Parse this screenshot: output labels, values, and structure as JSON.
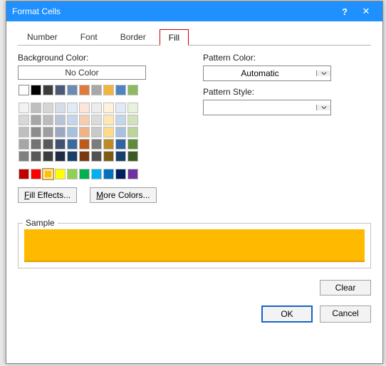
{
  "window": {
    "title": "Format Cells"
  },
  "tabs": {
    "items": [
      {
        "label": "Number"
      },
      {
        "label": "Font"
      },
      {
        "label": "Border"
      },
      {
        "label": "Fill"
      }
    ],
    "active_index": 3
  },
  "fill": {
    "background_color_label": "Background Color:",
    "no_color_label": "No Color",
    "fill_effects_label": "Fill Effects...",
    "more_colors_label": "More Colors...",
    "selected_index": 62,
    "colors": [
      "#ffffff",
      "#000000",
      "#3c3c3c",
      "#4a5a78",
      "#6b8bb3",
      "#e07a3c",
      "#a8a8a8",
      "#f2b63d",
      "#4f84c4",
      "#8fb95f",
      "#f2f2f2",
      "#bfbfbf",
      "#d6d6d6",
      "#d6dde8",
      "#e2ebf5",
      "#fbe6d9",
      "#ededed",
      "#fff3d9",
      "#e1eaf4",
      "#e8f1dc",
      "#d8d8d8",
      "#a6a6a6",
      "#bcbcbc",
      "#b9c4d6",
      "#c5d6ea",
      "#f6cdb1",
      "#dbdbdb",
      "#ffe8b3",
      "#c4d6ea",
      "#d2e2ba",
      "#bfbfbf",
      "#8c8c8c",
      "#9e9e9e",
      "#9aa9c2",
      "#a6c0de",
      "#f0b384",
      "#c9c9c9",
      "#ffdb87",
      "#a7c1de",
      "#bcd498",
      "#a6a6a6",
      "#737373",
      "#595959",
      "#425173",
      "#3b6aa0",
      "#c05a1a",
      "#7c7c7c",
      "#bd8b23",
      "#2e65a3",
      "#5f8c3a",
      "#808080",
      "#595959",
      "#3c3c3c",
      "#1e2b44",
      "#1b3e66",
      "#7a3910",
      "#525252",
      "#7d5b15",
      "#163f6b",
      "#3c5a23",
      "#c00000",
      "#ff0000",
      "#ffc000",
      "#ffff00",
      "#92d050",
      "#00b050",
      "#00b0f0",
      "#0070c0",
      "#002060",
      "#7030a0"
    ]
  },
  "pattern": {
    "color_label": "Pattern Color:",
    "color_value": "Automatic",
    "style_label": "Pattern Style:",
    "style_value": ""
  },
  "sample": {
    "label": "Sample",
    "color": "#ffba00"
  },
  "buttons": {
    "clear": "Clear",
    "ok": "OK",
    "cancel": "Cancel"
  }
}
